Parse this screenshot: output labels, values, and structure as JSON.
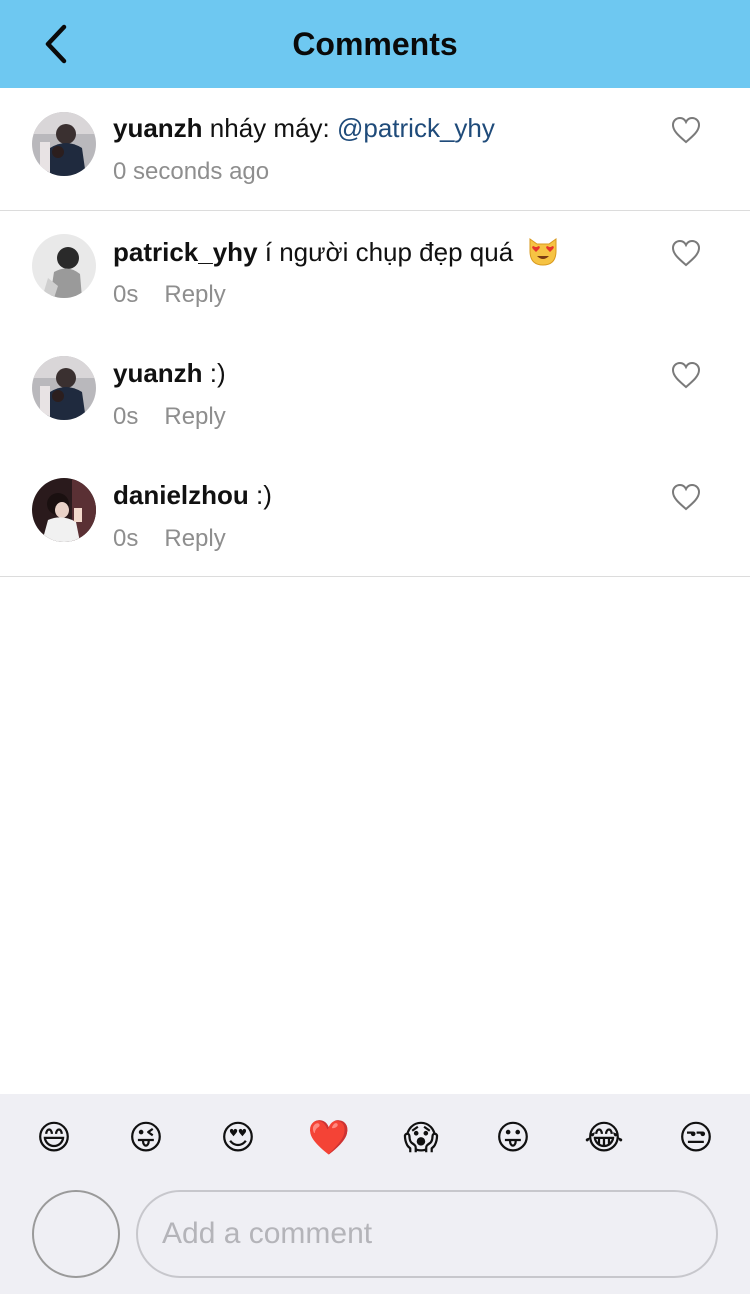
{
  "header": {
    "title": "Comments",
    "back_icon": "chevron-left-icon",
    "background": "#6ec8f1"
  },
  "comments": [
    {
      "username": "yuanzh",
      "text": " nháy máy: ",
      "mention": "@patrick_yhy",
      "time": "0 seconds ago",
      "reply": "",
      "liked": false
    },
    {
      "username": "patrick_yhy",
      "text": " í người chụp đẹp quá ",
      "emoji": "heart-eyes-cat-icon",
      "time": "0s",
      "reply": "Reply",
      "liked": false
    },
    {
      "username": "yuanzh",
      "text": " :)",
      "time": "0s",
      "reply": "Reply",
      "liked": false
    },
    {
      "username": "danielzhou",
      "text": " :)",
      "time": "0s",
      "reply": "Reply",
      "liked": false
    }
  ],
  "composer": {
    "emojis": [
      "😄",
      "😜",
      "😍",
      "❤️",
      "😱",
      "😛",
      "😂",
      "😒"
    ],
    "placeholder": "Add a comment",
    "value": ""
  }
}
